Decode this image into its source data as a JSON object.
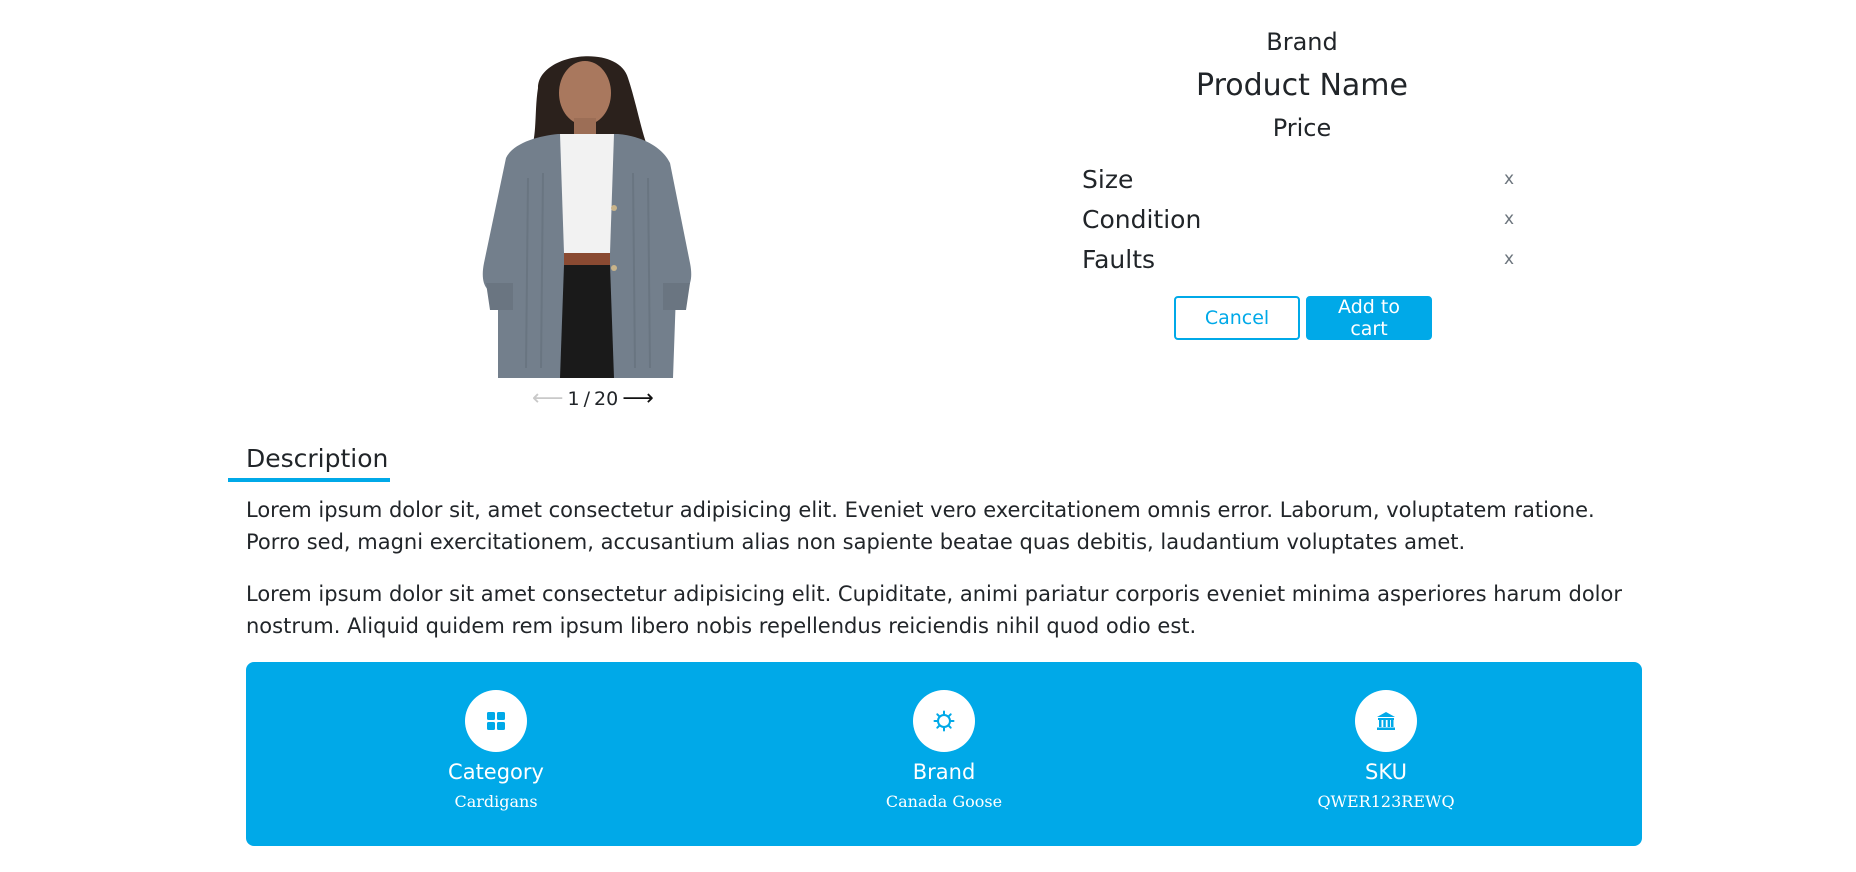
{
  "product": {
    "brand": "Brand",
    "name": "Product Name",
    "price": "Price",
    "attributes": [
      {
        "label": "Size",
        "value": "x"
      },
      {
        "label": "Condition",
        "value": "x"
      },
      {
        "label": "Faults",
        "value": "x"
      }
    ]
  },
  "gallery": {
    "current": "1",
    "separator": "/ ",
    "total": "20",
    "prev_icon": "arrow-left-icon",
    "next_icon": "arrow-right-icon"
  },
  "actions": {
    "cancel_label": "Cancel",
    "add_to_cart_label": "Add to cart"
  },
  "description": {
    "tab_label": "Description",
    "paragraphs": [
      "Lorem ipsum dolor sit, amet consectetur adipisicing elit. Eveniet vero exercitationem omnis error. Laborum, voluptatem ratione. Porro sed, magni exercitationem, accusantium alias non sapiente beatae quas debitis, laudantium voluptates amet.",
      "Lorem ipsum dolor sit amet consectetur adipisicing elit. Cupiditate, animi pariatur corporis eveniet minima asperiores harum dolor nostrum. Aliquid quidem rem ipsum libero nobis repellendus reiciendis nihil quod odio est."
    ]
  },
  "info_band": {
    "items": [
      {
        "icon": "grid-icon",
        "title": "Category",
        "value": "Cardigans"
      },
      {
        "icon": "gear-icon",
        "title": "Brand",
        "value": "Canada Goose"
      },
      {
        "icon": "bank-icon",
        "title": "SKU",
        "value": "QWER123REWQ"
      }
    ]
  },
  "colors": {
    "accent": "#00a9e8",
    "text": "#212529",
    "muted": "#6c757d"
  }
}
